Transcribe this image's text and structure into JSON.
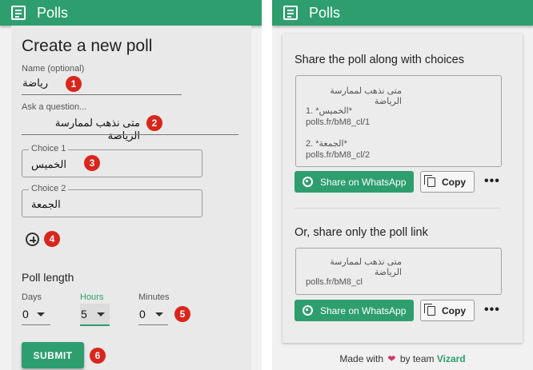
{
  "app": {
    "title": "Polls"
  },
  "create": {
    "heading": "Create a new poll",
    "name_label": "Name (optional)",
    "name_value": "رياضة",
    "question_label": "Ask a question...",
    "question_value": "متى نذهب لممارسة الرياضة",
    "choices": [
      {
        "label": "Choice 1",
        "value": "الخميس"
      },
      {
        "label": "Choice 2",
        "value": "الجمعة"
      }
    ],
    "poll_length_label": "Poll length",
    "days": {
      "label": "Days",
      "value": "0"
    },
    "hours": {
      "label": "Hours",
      "value": "5"
    },
    "minutes": {
      "label": "Minutes",
      "value": "0"
    },
    "submit_label": "SUBMIT"
  },
  "badges": [
    "1",
    "2",
    "3",
    "4",
    "5",
    "6"
  ],
  "share": {
    "heading_choices": "Share the poll along with choices",
    "choices_text": {
      "question": "متى نذهب لممارسة الرياضة",
      "choice1_line": "1. *الخميس*",
      "choice1_link": "polls.fr/bM8_cl/1",
      "choice2_line": "2. *الجمعة*",
      "choice2_link": "polls.fr/bM8_cl/2"
    },
    "heading_link": "Or, share only the poll link",
    "link_text": {
      "question": "متى نذهب لممارسة الرياضة",
      "link": "polls.fr/bM8_cl"
    },
    "whatsapp_label": "Share on WhatsApp",
    "copy_label": "Copy",
    "more_label": "•••"
  },
  "footer": {
    "prefix": "Made with",
    "middle": "by team",
    "brand": "Vizard"
  },
  "colors": {
    "primary": "#2e9e6e",
    "badge": "#d9261c",
    "heart": "#d6336c"
  },
  "icons": [
    "document-icon",
    "add-circle-icon",
    "dropdown-caret-icon",
    "whatsapp-icon",
    "copy-icon",
    "more-icon",
    "heart-icon"
  ]
}
